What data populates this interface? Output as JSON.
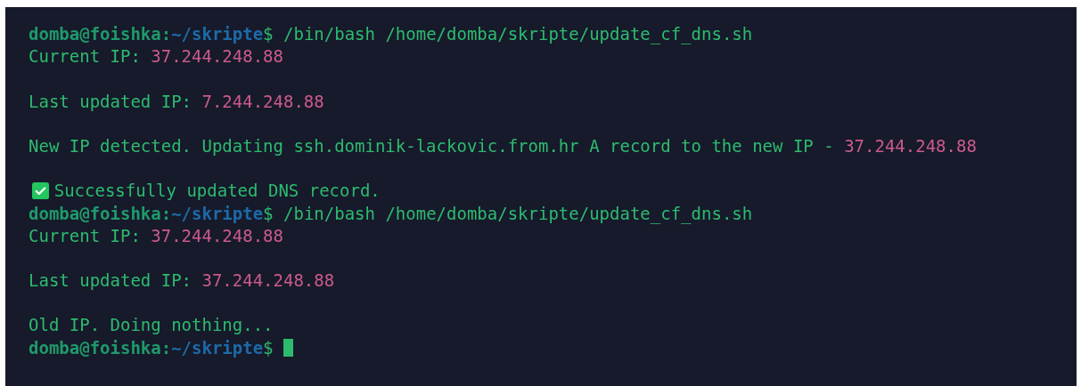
{
  "terminal": {
    "lines": [
      {
        "kind": "prompt",
        "user": "domba@foishka:",
        "path": "~/skripte",
        "sign": "$",
        "command": "/bin/bash /home/domba/skripte/update_cf_dns.sh",
        "cursor": false
      },
      {
        "kind": "output",
        "segments": [
          {
            "kind": "text",
            "text": "Current IP: "
          },
          {
            "kind": "value",
            "text": "37.244.248.88"
          }
        ]
      },
      {
        "kind": "blank"
      },
      {
        "kind": "output",
        "segments": [
          {
            "kind": "text",
            "text": "Last updated IP: "
          },
          {
            "kind": "value",
            "text": "7.244.248.88"
          }
        ]
      },
      {
        "kind": "blank"
      },
      {
        "kind": "output",
        "segments": [
          {
            "kind": "text",
            "text": "New IP detected. Updating ssh.dominik-lackovic.from.hr A record to the new IP - "
          },
          {
            "kind": "value",
            "text": "37.244.248.88"
          }
        ]
      },
      {
        "kind": "blank"
      },
      {
        "kind": "output",
        "segments": [
          {
            "kind": "check"
          },
          {
            "kind": "text",
            "text": "Successfully updated DNS record."
          }
        ]
      },
      {
        "kind": "prompt",
        "user": "domba@foishka:",
        "path": "~/skripte",
        "sign": "$",
        "command": "/bin/bash /home/domba/skripte/update_cf_dns.sh",
        "cursor": false
      },
      {
        "kind": "output",
        "segments": [
          {
            "kind": "text",
            "text": "Current IP: "
          },
          {
            "kind": "value",
            "text": "37.244.248.88"
          }
        ]
      },
      {
        "kind": "blank"
      },
      {
        "kind": "output",
        "segments": [
          {
            "kind": "text",
            "text": "Last updated IP: "
          },
          {
            "kind": "value",
            "text": "37.244.248.88"
          }
        ]
      },
      {
        "kind": "blank"
      },
      {
        "kind": "output",
        "segments": [
          {
            "kind": "text",
            "text": "Old IP. Doing nothing..."
          }
        ]
      },
      {
        "kind": "prompt",
        "user": "domba@foishka:",
        "path": "~/skripte",
        "sign": "$",
        "cursor": true
      }
    ]
  }
}
